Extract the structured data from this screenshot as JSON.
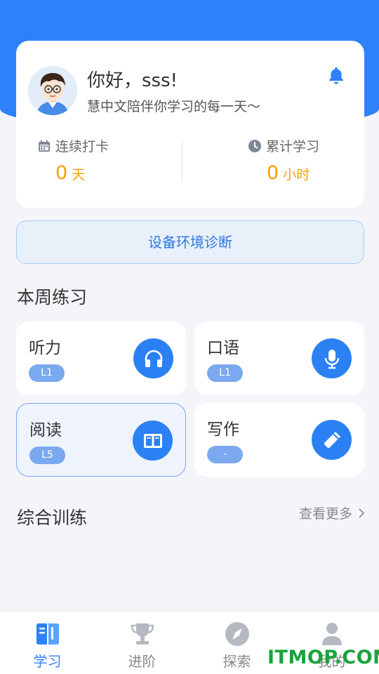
{
  "profile": {
    "greeting": "你好，sss!",
    "motto": "慧中文陪伴你学习的每一天～",
    "checkin_label": "连续打卡",
    "checkin_value": "0",
    "checkin_unit": "天",
    "study_label": "累计学习",
    "study_value": "0",
    "study_unit": "小时"
  },
  "diagnose_button": "设备环境诊断",
  "weekly": {
    "title": "本周练习",
    "tiles": [
      {
        "name": "听力",
        "level": "L1",
        "icon": "headphones-icon"
      },
      {
        "name": "口语",
        "level": "L1",
        "icon": "microphone-icon"
      },
      {
        "name": "阅读",
        "level": "L5",
        "icon": "book-icon"
      },
      {
        "name": "写作",
        "level": "-",
        "icon": "pencil-icon"
      }
    ]
  },
  "comprehensive": {
    "title": "综合训练",
    "more": "查看更多"
  },
  "tabbar": [
    {
      "label": "学习",
      "icon": "book-icon",
      "active": true
    },
    {
      "label": "进阶",
      "icon": "trophy-icon",
      "active": false
    },
    {
      "label": "探索",
      "icon": "compass-icon",
      "active": false
    },
    {
      "label": "我的",
      "icon": "user-icon",
      "active": false
    }
  ],
  "watermark": "ITMOP.COM",
  "colors": {
    "primary": "#2d82fa",
    "accent": "#f5a200",
    "badge": "#7ba9f0",
    "watermark": "#19a33a"
  }
}
